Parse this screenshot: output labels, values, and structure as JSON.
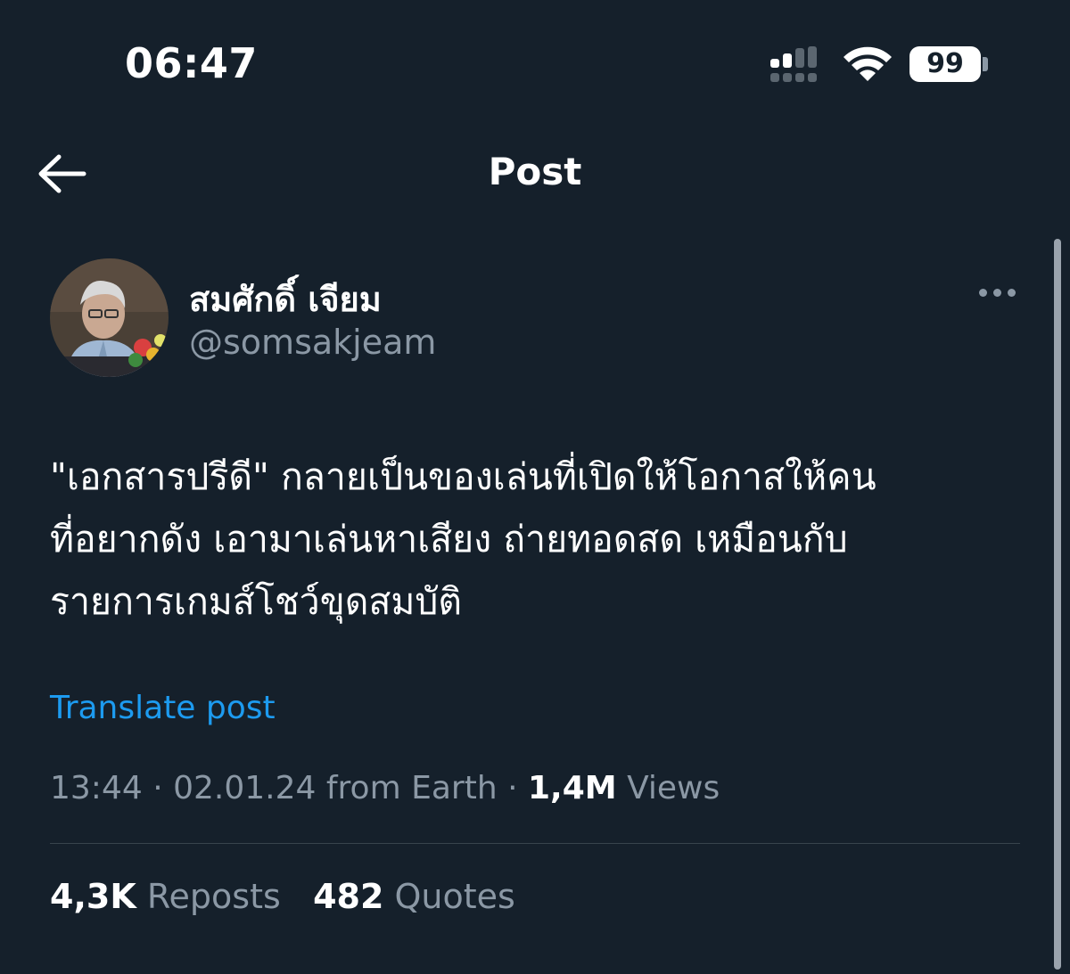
{
  "status_bar": {
    "time": "06:47",
    "battery_level": "99",
    "icons": [
      "signal-icon",
      "wifi-icon",
      "battery-icon"
    ]
  },
  "header": {
    "title": "Post",
    "back_icon": "arrow-left-icon"
  },
  "author": {
    "display_name": "สมศักดิ์ เจียม",
    "handle": "@somsakjeam",
    "more_icon": "more-horizontal-icon"
  },
  "post": {
    "text": "\"เอกสารปรีดี\" กลายเป็นของเล่นที่เปิดให้โอกาสให้คน\nที่อยากดัง เอามาเล่นหาเสียง ถ่ายทอดสด เหมือนกับ\nรายการเกมส์โชว์ขุดสมบัติ",
    "translate_label": "Translate post"
  },
  "meta": {
    "time": "13:44",
    "separator": "·",
    "date": "02.01.24",
    "location": "from Earth",
    "views_count": "1,4M",
    "views_label": "Views"
  },
  "stats": {
    "reposts_count": "4,3K",
    "reposts_label": "Reposts",
    "quotes_count": "482",
    "quotes_label": "Quotes"
  },
  "colors": {
    "background": "#15202b",
    "text_primary": "#ffffff",
    "text_secondary": "#8b98a5",
    "link": "#1d9bf0",
    "divider": "#38444d"
  }
}
